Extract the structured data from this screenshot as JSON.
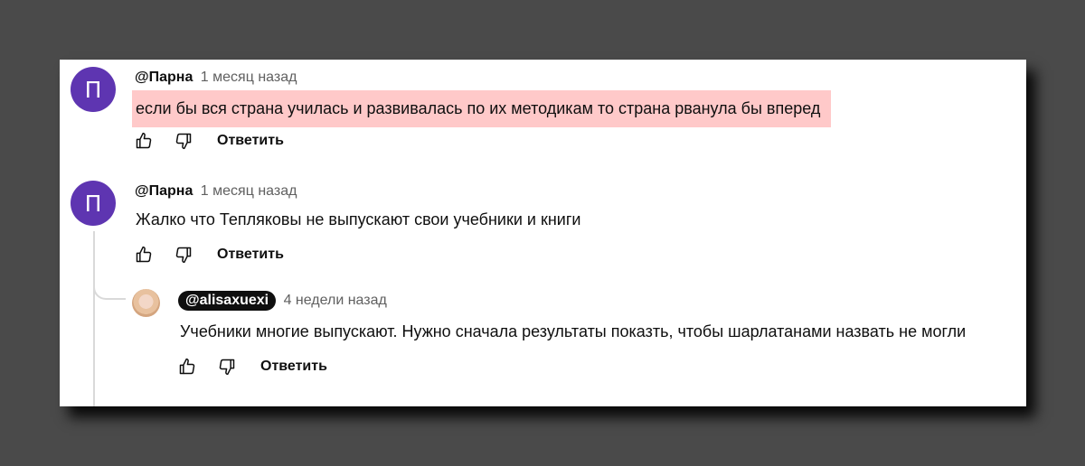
{
  "comments": [
    {
      "avatar_letter": "П",
      "author": "@Парна",
      "time": "1 месяц назад",
      "text": "если бы вся страна училась и развивалась по их методикам то страна рванула бы вперед",
      "reply_label": "Ответить"
    },
    {
      "avatar_letter": "П",
      "author": "@Парна",
      "time": "1 месяц назад",
      "text": "Жалко что Тепляковы не выпускают свои учебники и книги",
      "reply_label": "Ответить"
    }
  ],
  "reply": {
    "author": "@alisaxuexi",
    "time": "4 недели назад",
    "text": "Учебники многие выпускают. Нужно сначала результаты показть, чтобы шарлатанами назвать не  могли",
    "reply_label": "Ответить"
  }
}
